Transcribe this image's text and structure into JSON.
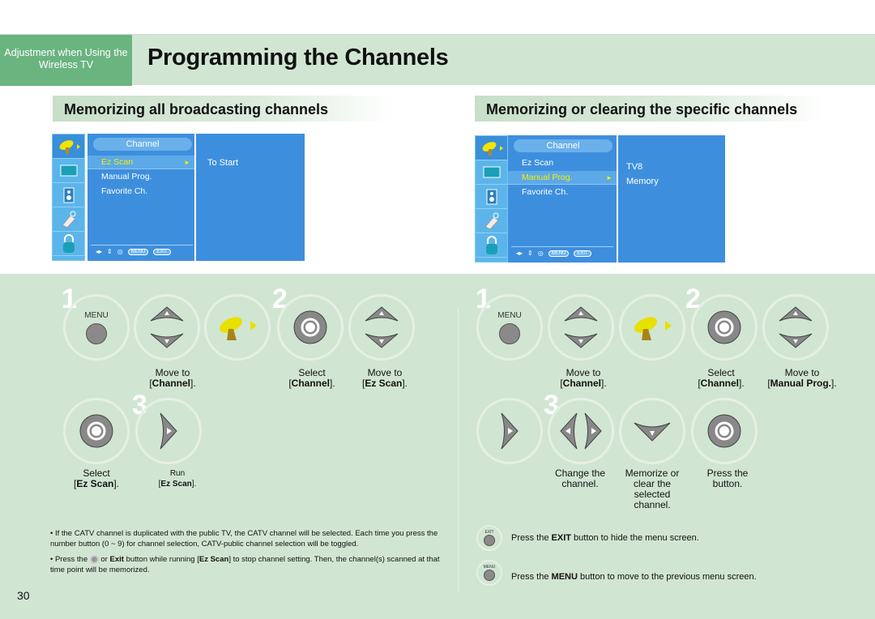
{
  "header": {
    "section": "Adjustment when Using the Wireless TV",
    "title": "Programming the Channels"
  },
  "left": {
    "heading": "Memorizing all broadcasting channels",
    "osd": {
      "menu_title": "Channel",
      "items": [
        "Ez Scan",
        "Manual Prog.",
        "Favorite Ch."
      ],
      "selected": "Ez Scan",
      "right_text": "To Start",
      "footer": {
        "menu": "MENU",
        "exit": "EXIT"
      }
    },
    "steps": {
      "step1": "1",
      "step2": "2",
      "step3": "3",
      "menu_label": "MENU",
      "cap_move_channel": {
        "line1": "Move to",
        "bold": "Channel"
      },
      "cap_select_channel": {
        "line1": "Select",
        "bold": "Channel"
      },
      "cap_move_ezscan": {
        "line1": "Move to",
        "bold": "Ez Scan"
      },
      "cap_select_ezscan": {
        "line1": "Select",
        "bold": "Ez Scan"
      },
      "cap_run_ezscan": {
        "line1": "Run",
        "bold": "Ez Scan"
      }
    },
    "notes": [
      "If the CATV channel is duplicated with the public TV, the CATV channel will be selected. Each time you press the number button (0 ~ 9) for channel selection, CATV-public channel selection will be toggled.",
      {
        "pre": "Press the",
        "mid": "or",
        "bold1": "Exit",
        "post1": "button while running [",
        "bold2": "Ez Scan",
        "post2": "] to stop channel setting. Then, the channel(s) scanned at that time point will be memorized."
      }
    ]
  },
  "right": {
    "heading": "Memorizing or clearing the specific channels",
    "osd": {
      "menu_title": "Channel",
      "items": [
        "Ez Scan",
        "Manual Prog.",
        "Favorite Ch."
      ],
      "selected": "Manual Prog.",
      "right_lines": [
        "TV8",
        "Memory"
      ],
      "footer": {
        "menu": "MENU",
        "exit": "EXIT"
      }
    },
    "steps": {
      "step1": "1",
      "step2": "2",
      "step3": "3",
      "menu_label": "MENU",
      "cap_move_channel": {
        "line1": "Move to",
        "bold": "Channel"
      },
      "cap_select_channel": {
        "line1": "Select",
        "bold": "Channel"
      },
      "cap_move_manual": {
        "line1": "Move to",
        "bold": "Manual Prog."
      },
      "cap_change": "Change the channel.",
      "cap_memorize": "Memorize or clear the selected channel.",
      "cap_press": "Press the button."
    },
    "tips": [
      {
        "btn": "EXIT",
        "pre": "Press the",
        "bold": "EXIT",
        "post": "button to hide the menu screen."
      },
      {
        "btn": "MENU",
        "pre": "Press the",
        "bold": "MENU",
        "post": "button to move to the previous menu screen."
      }
    ]
  },
  "page_number": "30"
}
